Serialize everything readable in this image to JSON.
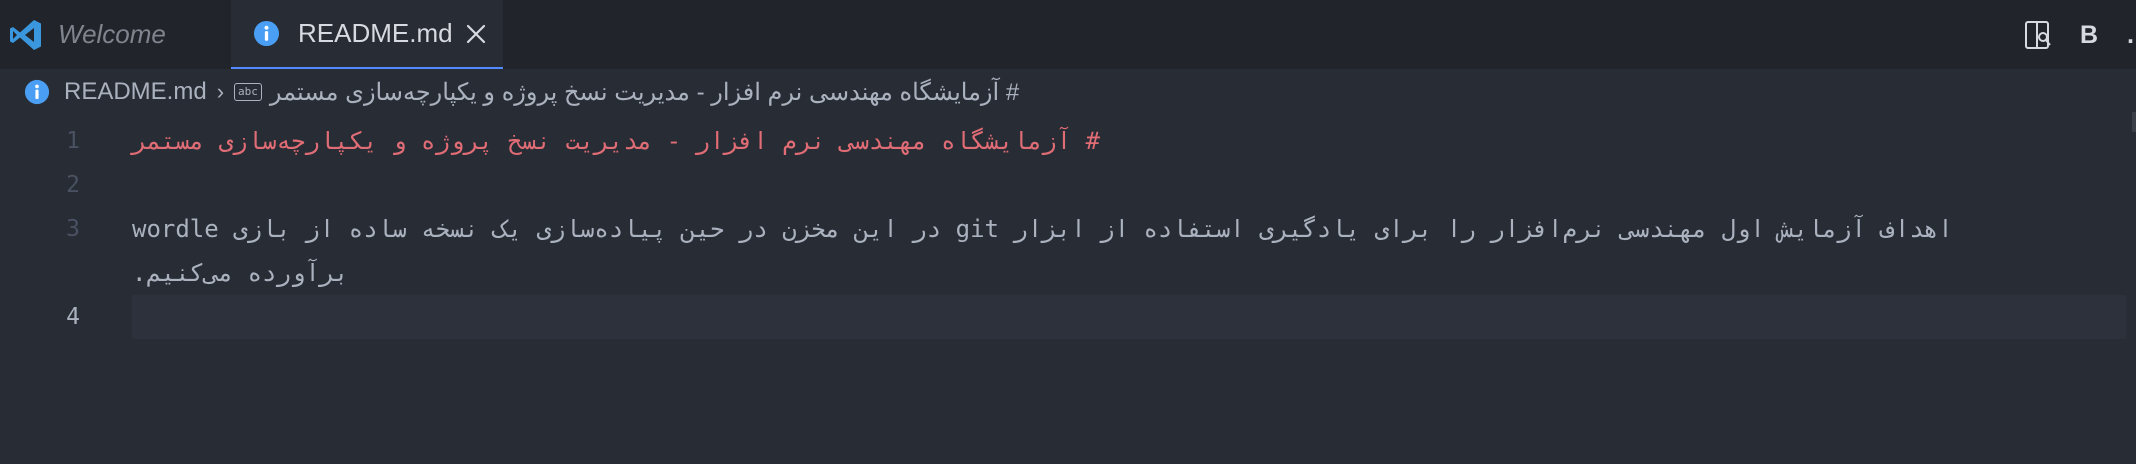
{
  "tabs": {
    "welcome_label": "Welcome",
    "readme_label": "README.md"
  },
  "actions": {
    "bold_label": "B",
    "more_label": "…"
  },
  "breadcrumb": {
    "file": "README.md",
    "heading": "# آزمایشگاه مهندسی نرم افزار - مدیریت نسخ پروژه و یکپارچه‌سازی مستمر",
    "abc_label": "abc"
  },
  "editor": {
    "line_numbers": [
      "1",
      "2",
      "3",
      "4"
    ],
    "line1": "# آزمایشگاه مهندسی نرم افزار - مدیریت نسخ پروژه و یکپارچه‌سازی مستمر",
    "line3a": "اهداف آزمایش اول مهندسی نرم‌افزار را برای یادگیری استفاده از ابزار git در این مخزن در حین پیاده‌سازی یک نسخه ساده از بازی wordle",
    "line3b": "برآورده می‌کنیم."
  },
  "colors": {
    "heading": "#e06c75",
    "accent": "#528bff",
    "info_icon": "#4a9ff5",
    "vscode_logo": "#3a96dd"
  }
}
